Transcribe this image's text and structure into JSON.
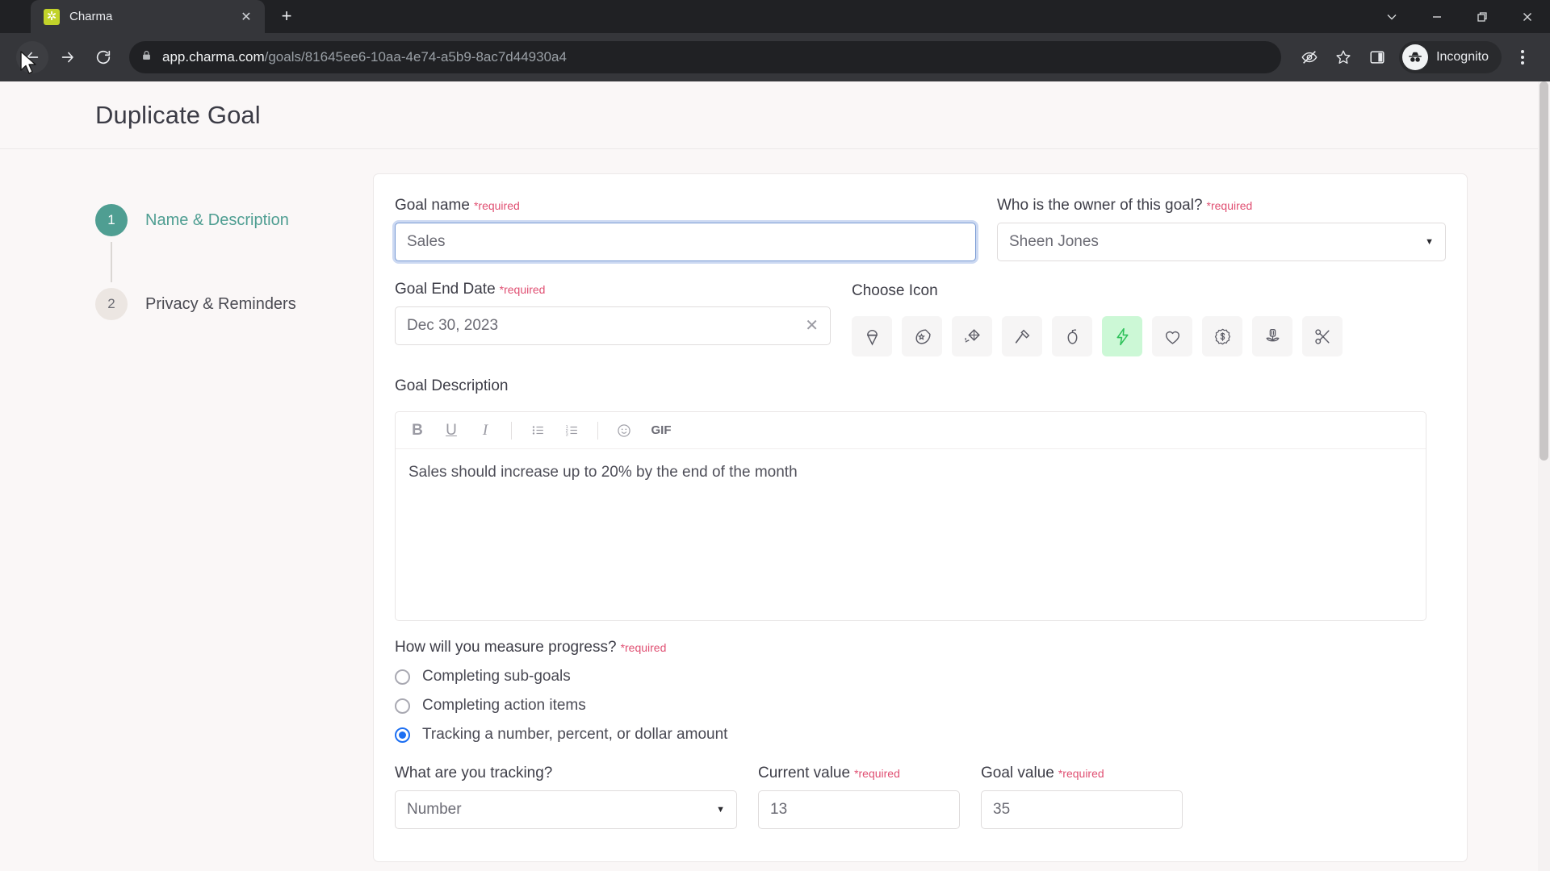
{
  "browser": {
    "tab": {
      "title": "Charma",
      "favicon_icon": "star-favicon",
      "close_icon": "close-icon"
    },
    "new_tab_icon": "plus-icon",
    "window_controls": [
      {
        "name": "tab-search",
        "icon": "chevron-down-icon"
      },
      {
        "name": "minimize",
        "icon": "minimize-icon"
      },
      {
        "name": "maximize",
        "icon": "restore-icon"
      },
      {
        "name": "close",
        "icon": "close-icon"
      }
    ],
    "nav": {
      "back_icon": "back-arrow-icon",
      "forward_icon": "forward-arrow-icon",
      "reload_icon": "reload-icon"
    },
    "omnibox": {
      "lock_icon": "lock-icon",
      "url_host": "app.charma.com",
      "url_path": "/goals/81645ee6-10aa-4e74-a5b9-8ac7d44930a4"
    },
    "toolbar_icons": [
      {
        "name": "third-party-cookie-blocked-icon",
        "icon": "eye-slash-icon"
      },
      {
        "name": "bookmark-icon",
        "icon": "star-outline-icon"
      },
      {
        "name": "side-panel-icon",
        "icon": "panel-icon"
      }
    ],
    "profile": {
      "label": "Incognito",
      "icon": "incognito-icon"
    },
    "menu_icon": "kebab-menu-icon"
  },
  "page": {
    "title": "Duplicate Goal"
  },
  "stepper": {
    "steps": [
      {
        "num": "1",
        "label": "Name & Description",
        "state": "active"
      },
      {
        "num": "2",
        "label": "Privacy & Reminders",
        "state": "inactive"
      }
    ]
  },
  "form": {
    "required_marker": "*required",
    "goal_name": {
      "label": "Goal name",
      "value": "Sales",
      "required": true,
      "focused": true
    },
    "owner": {
      "label": "Who is the owner of this goal?",
      "value": "Sheen Jones",
      "required": true,
      "caret_icon": "chevron-down-icon"
    },
    "end_date": {
      "label": "Goal End Date",
      "value": "Dec 30, 2023",
      "required": true,
      "clear_icon": "close-icon"
    },
    "choose_icon": {
      "label": "Choose Icon",
      "selected_index": 5,
      "selected_color": "#2fc25b",
      "selected_bg": "#ccf8d6",
      "icons": [
        {
          "name": "ice-cream-icon"
        },
        {
          "name": "comet-icon"
        },
        {
          "name": "kite-icon"
        },
        {
          "name": "hammer-icon"
        },
        {
          "name": "apple-icon"
        },
        {
          "name": "lightning-bolt-icon"
        },
        {
          "name": "heart-icon"
        },
        {
          "name": "dollar-badge-icon"
        },
        {
          "name": "flower-icon"
        },
        {
          "name": "scissors-icon"
        }
      ]
    },
    "description": {
      "label": "Goal Description",
      "value": "Sales should increase up to 20% by the end of the month",
      "toolbar": [
        {
          "name": "bold-icon",
          "glyph": "B"
        },
        {
          "name": "underline-icon",
          "glyph": "U"
        },
        {
          "name": "italic-icon",
          "glyph": "I"
        },
        {
          "name": "divider-1",
          "glyph": ""
        },
        {
          "name": "bulleted-list-icon",
          "glyph": ""
        },
        {
          "name": "numbered-list-icon",
          "glyph": ""
        },
        {
          "name": "divider-2",
          "glyph": ""
        },
        {
          "name": "emoji-icon",
          "glyph": ""
        },
        {
          "name": "gif-icon",
          "glyph": "GIF"
        }
      ]
    },
    "measure": {
      "label": "How will you measure progress?",
      "required": true,
      "options": [
        {
          "label": "Completing sub-goals",
          "checked": false
        },
        {
          "label": "Completing action items",
          "checked": false
        },
        {
          "label": "Tracking a number, percent, or dollar amount",
          "checked": true
        }
      ]
    },
    "tracking_type": {
      "label": "What are you tracking?",
      "value": "Number",
      "caret_icon": "chevron-down-icon"
    },
    "current_value": {
      "label": "Current value",
      "value": "13",
      "required": true
    },
    "goal_value": {
      "label": "Goal value",
      "value": "35",
      "required": true
    }
  },
  "colors": {
    "accent_teal": "#4f9e92",
    "required_pink": "#e04f72",
    "focus_blue": "#1d6ff2",
    "page_bg": "#faf7f7"
  }
}
